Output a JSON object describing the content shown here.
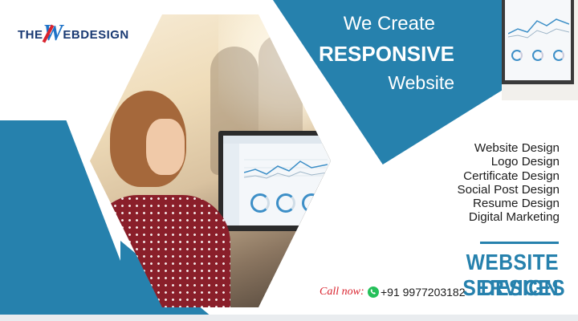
{
  "logo": {
    "part1": "THE",
    "part2": "W",
    "part3": "EBDESIGN"
  },
  "headline": {
    "line1": "We Create",
    "line2": "RESPONSIVE",
    "line3": "Website"
  },
  "services": [
    "Website Design",
    "Logo Design",
    "Certificate Design",
    "Social Post Design",
    "Resume Design",
    "Digital Marketing"
  ],
  "banner": {
    "line1": "WEBSITE DESIGN",
    "line2": "SERVICES"
  },
  "contact": {
    "call_label": "Call now:",
    "phone": "+91 9977203182"
  },
  "colors": {
    "brand_blue": "#2681ad",
    "logo_navy": "#1a3a73",
    "accent_red": "#d9232e",
    "whatsapp_green": "#25c05a"
  },
  "icons": {
    "contact": "whatsapp-icon"
  }
}
